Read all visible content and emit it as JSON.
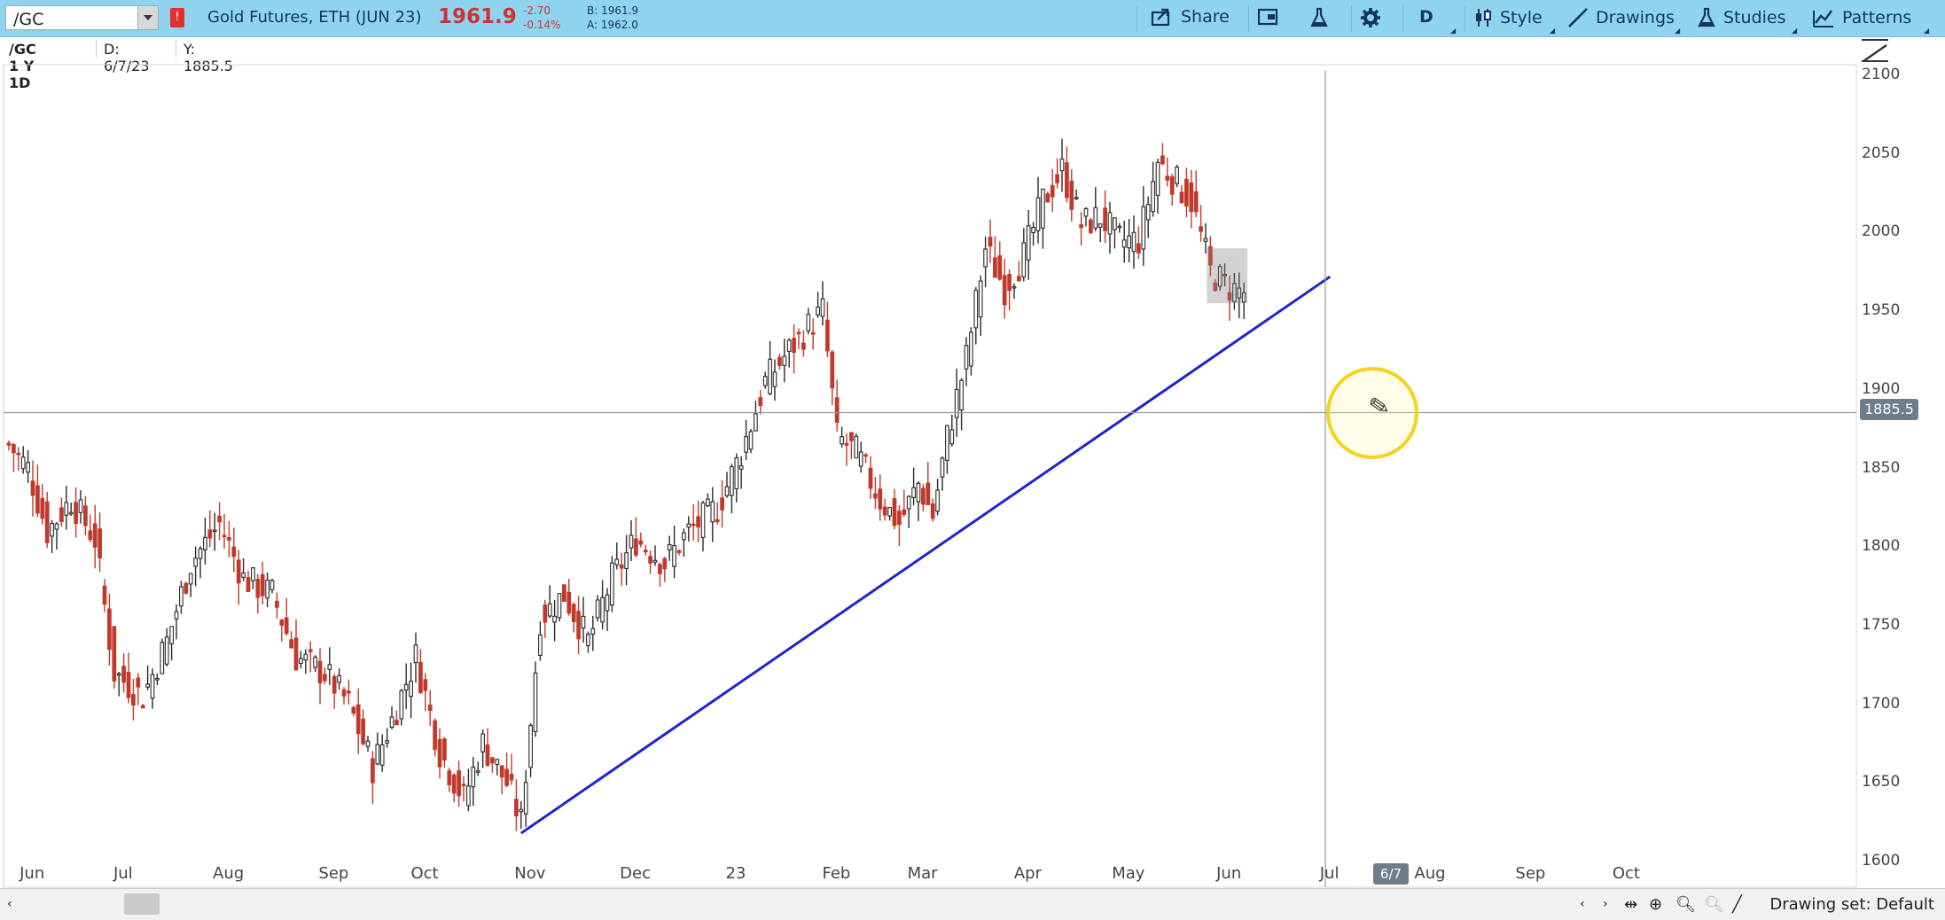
{
  "toolbar": {
    "symbol": "/GC",
    "alert_count": "!",
    "description": "Gold Futures, ETH (JUN 23)",
    "last_price": "1961.9",
    "net_change": "-2.70",
    "pct_change": "-0.14%",
    "bid": "B: 1961.9",
    "ask": "A: 1962.0",
    "share_label": "Share",
    "aggregation": "D",
    "style_label": "Style",
    "drawings_label": "Drawings",
    "studies_label": "Studies",
    "patterns_label": "Patterns",
    "icons": [
      "share-icon",
      "chart-settings-icon",
      "flask-icon",
      "gear-icon",
      "candles-icon",
      "line-icon",
      "studies-flask-icon",
      "patterns-icon"
    ]
  },
  "info": {
    "chart_label": "/GC 1 Y 1D",
    "date_label": "D: 6/7/23",
    "y_label": "Y: 1885.5"
  },
  "crosshair": {
    "price_label": "1885.5",
    "date_label": "6/7",
    "price_value": 1885.5
  },
  "bottom": {
    "drawing_set": "Drawing set: Default"
  },
  "colors": {
    "toolbar_bg": "#8fd3ef",
    "up_candle": "#2a2a2a",
    "down_candle": "#c0392b",
    "trendline": "#2323c8",
    "highlight": "#f5d31a"
  },
  "chart_data": {
    "type": "candlestick",
    "y_ticks": [
      2100,
      2050,
      2000,
      1950,
      1900,
      1850,
      1800,
      1750,
      1700,
      1650,
      1600
    ],
    "ylim": [
      1600,
      2110
    ],
    "x_ticks": [
      "Jun",
      "Jul",
      "Aug",
      "Sep",
      "Oct",
      "Nov",
      "Dec",
      "23",
      "Feb",
      "Mar",
      "Apr",
      "May",
      "Jun",
      "Jul",
      "Aug",
      "Sep",
      "Oct"
    ],
    "grid": false,
    "price_path": [
      {
        "x": 0,
        "close": 1865
      },
      {
        "x": 4,
        "close": 1850
      },
      {
        "x": 8,
        "close": 1810
      },
      {
        "x": 13,
        "close": 1830
      },
      {
        "x": 18,
        "close": 1805
      },
      {
        "x": 22,
        "close": 1720
      },
      {
        "x": 28,
        "close": 1705
      },
      {
        "x": 33,
        "close": 1740
      },
      {
        "x": 38,
        "close": 1790
      },
      {
        "x": 44,
        "close": 1815
      },
      {
        "x": 49,
        "close": 1780
      },
      {
        "x": 55,
        "close": 1770
      },
      {
        "x": 60,
        "close": 1730
      },
      {
        "x": 66,
        "close": 1720
      },
      {
        "x": 71,
        "close": 1700
      },
      {
        "x": 76,
        "close": 1660
      },
      {
        "x": 80,
        "close": 1690
      },
      {
        "x": 85,
        "close": 1730
      },
      {
        "x": 90,
        "close": 1670
      },
      {
        "x": 95,
        "close": 1640
      },
      {
        "x": 99,
        "close": 1675
      },
      {
        "x": 104,
        "close": 1650
      },
      {
        "x": 107,
        "close": 1625
      },
      {
        "x": 111,
        "close": 1755
      },
      {
        "x": 116,
        "close": 1770
      },
      {
        "x": 121,
        "close": 1740
      },
      {
        "x": 126,
        "close": 1780
      },
      {
        "x": 131,
        "close": 1805
      },
      {
        "x": 137,
        "close": 1790
      },
      {
        "x": 142,
        "close": 1810
      },
      {
        "x": 148,
        "close": 1825
      },
      {
        "x": 153,
        "close": 1860
      },
      {
        "x": 158,
        "close": 1905
      },
      {
        "x": 163,
        "close": 1925
      },
      {
        "x": 167,
        "close": 1940
      },
      {
        "x": 170,
        "close": 1950
      },
      {
        "x": 173,
        "close": 1870
      },
      {
        "x": 177,
        "close": 1860
      },
      {
        "x": 182,
        "close": 1830
      },
      {
        "x": 186,
        "close": 1815
      },
      {
        "x": 190,
        "close": 1840
      },
      {
        "x": 193,
        "close": 1820
      },
      {
        "x": 196,
        "close": 1870
      },
      {
        "x": 200,
        "close": 1920
      },
      {
        "x": 204,
        "close": 1990
      },
      {
        "x": 208,
        "close": 1965
      },
      {
        "x": 212,
        "close": 1985
      },
      {
        "x": 216,
        "close": 2020
      },
      {
        "x": 220,
        "close": 2040
      },
      {
        "x": 224,
        "close": 2005
      },
      {
        "x": 228,
        "close": 2010
      },
      {
        "x": 232,
        "close": 1995
      },
      {
        "x": 236,
        "close": 1995
      },
      {
        "x": 240,
        "close": 2045
      },
      {
        "x": 243,
        "close": 2035
      },
      {
        "x": 247,
        "close": 2020
      },
      {
        "x": 251,
        "close": 1975
      },
      {
        "x": 255,
        "close": 1965
      },
      {
        "x": 258,
        "close": 1962
      }
    ],
    "trendline": {
      "x1": 107,
      "y1": 1618,
      "x2": 276,
      "y2": 1972
    },
    "crosshair_x": 275,
    "crosshair_y": 1885.5,
    "highlight_range": {
      "x1": 251,
      "y1": 1955,
      "x2": 258,
      "y2": 1990
    }
  }
}
